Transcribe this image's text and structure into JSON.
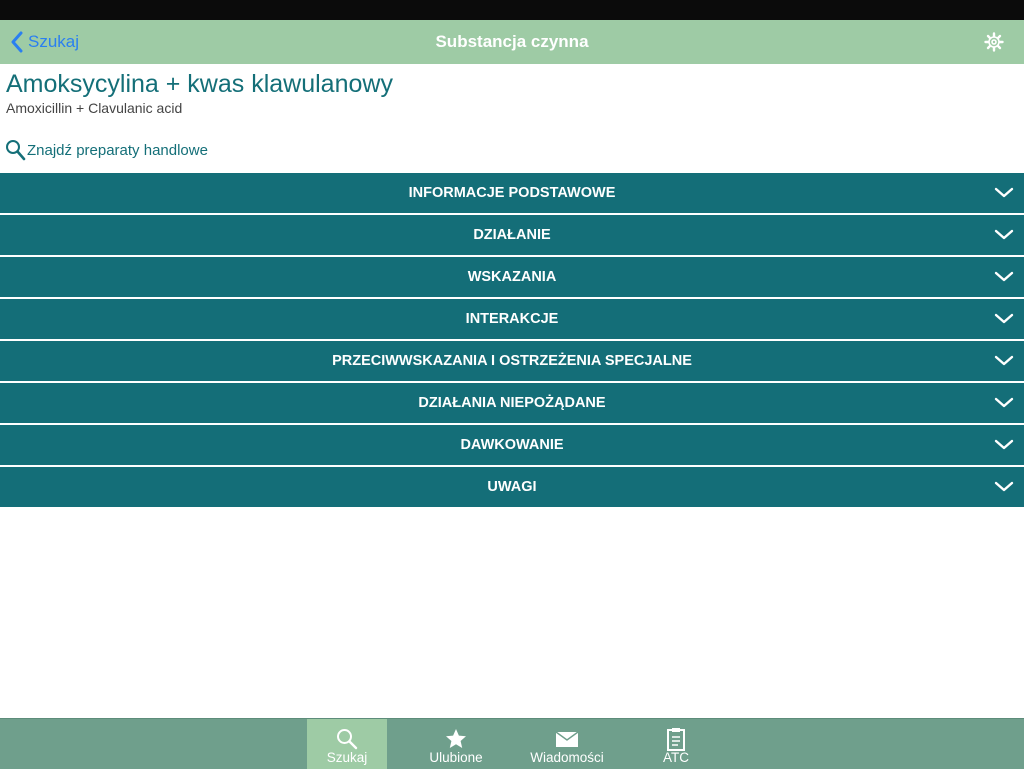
{
  "nav": {
    "back_label": "Szukaj",
    "title": "Substancja czynna",
    "settings_icon": "gear-icon"
  },
  "substance": {
    "name": "Amoksycylina + kwas klawulanowy",
    "latin_name": "Amoxicillin + Clavulanic acid"
  },
  "find_link": {
    "label": "Znajdź preparaty handlowe",
    "icon": "search-icon"
  },
  "sections": [
    {
      "label": "INFORMACJE PODSTAWOWE"
    },
    {
      "label": "DZIAŁANIE"
    },
    {
      "label": "WSKAZANIA"
    },
    {
      "label": "INTERAKCJE"
    },
    {
      "label": "PRZECIWWSKAZANIA I OSTRZEŻENIA SPECJALNE"
    },
    {
      "label": "DZIAŁANIA NIEPOŻĄDANE"
    },
    {
      "label": "DAWKOWANIE"
    },
    {
      "label": "UWAGI"
    }
  ],
  "tabs": [
    {
      "label": "Szukaj",
      "icon": "search-icon",
      "active": true
    },
    {
      "label": "Ulubione",
      "icon": "star-icon",
      "active": false
    },
    {
      "label": "Wiadomości",
      "icon": "envelope-icon",
      "active": false
    },
    {
      "label": "ATC",
      "icon": "clipboard-icon",
      "active": false
    }
  ],
  "colors": {
    "nav_background": "#9ecba5",
    "section_background": "#146e78",
    "tab_bar_background": "#6f9f8c",
    "accent_text": "#146f78",
    "back_link": "#2a7ff0"
  }
}
